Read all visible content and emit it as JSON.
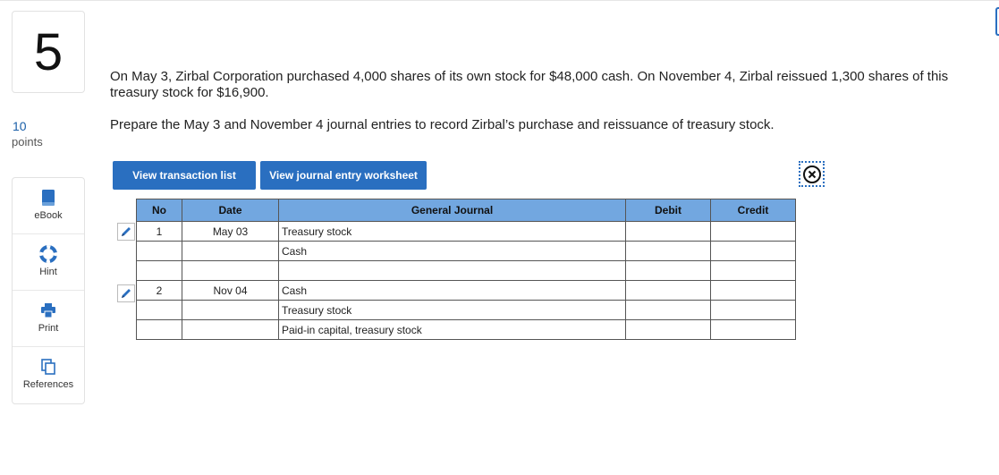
{
  "question": {
    "number": "5",
    "points_value": "10",
    "points_label": "points",
    "text": "On May 3, Zirbal Corporation purchased 4,000 shares of its own stock for $48,000 cash. On November 4, Zirbal reissued 1,300 shares of this treasury stock for $16,900.",
    "instruction": "Prepare the May 3 and November 4 journal entries to record Zirbal’s purchase and reissuance of treasury stock."
  },
  "tools": [
    {
      "label": "eBook",
      "icon": "book-icon"
    },
    {
      "label": "Hint",
      "icon": "lifebuoy-icon"
    },
    {
      "label": "Print",
      "icon": "printer-icon"
    },
    {
      "label": "References",
      "icon": "documents-icon"
    }
  ],
  "buttons": {
    "transaction_list": "View transaction list",
    "journal_worksheet": "View journal entry worksheet"
  },
  "journal": {
    "headers": {
      "no": "No",
      "date": "Date",
      "general_journal": "General Journal",
      "debit": "Debit",
      "credit": "Credit"
    },
    "rows": [
      {
        "no": "1",
        "date": "May 03",
        "account": "Treasury stock",
        "debit": "",
        "credit": ""
      },
      {
        "no": "",
        "date": "",
        "account": "Cash",
        "debit": "",
        "credit": ""
      },
      {
        "no": "",
        "date": "",
        "account": "",
        "debit": "",
        "credit": ""
      },
      {
        "no": "2",
        "date": "Nov 04",
        "account": "Cash",
        "debit": "",
        "credit": ""
      },
      {
        "no": "",
        "date": "",
        "account": "Treasury stock",
        "debit": "",
        "credit": ""
      },
      {
        "no": "",
        "date": "",
        "account": "Paid-in capital, treasury stock",
        "debit": "",
        "credit": ""
      }
    ]
  },
  "colors": {
    "accent": "#2a6fc0",
    "table_header": "#72a7e0"
  }
}
